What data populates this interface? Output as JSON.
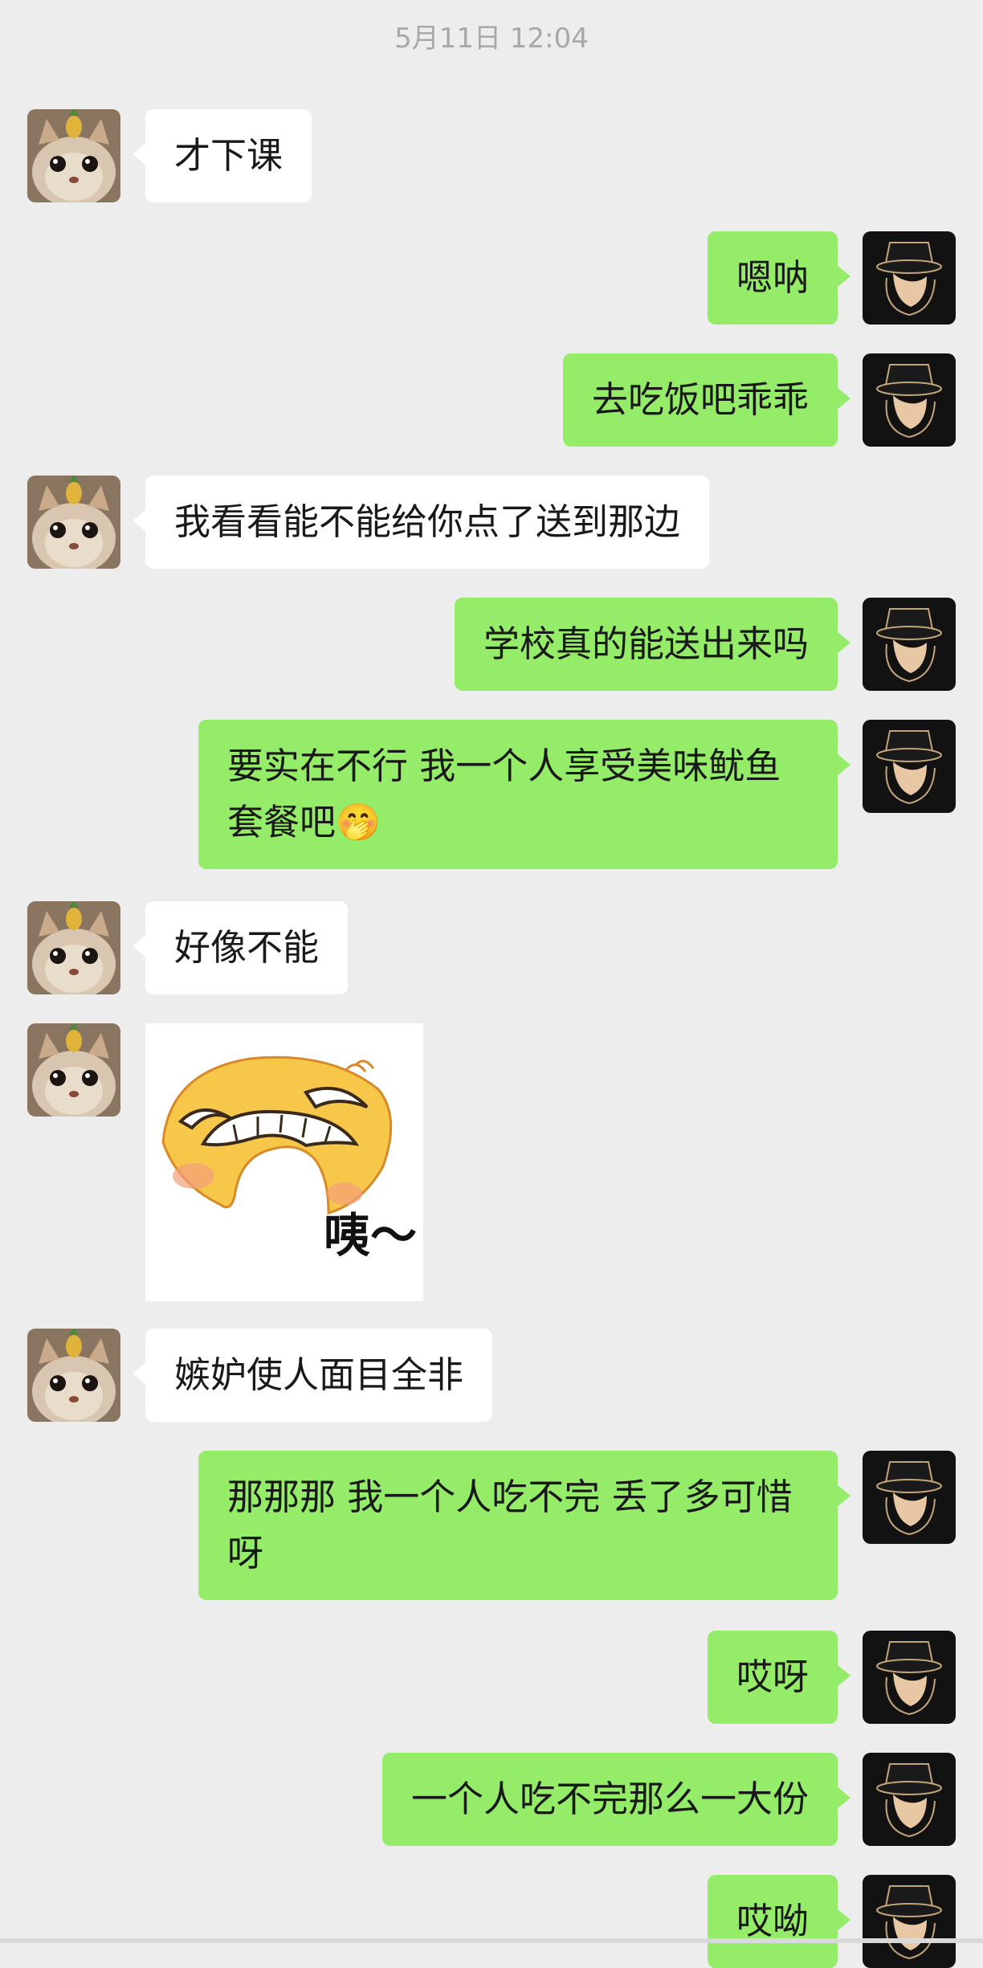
{
  "timestamp": "5月11日 12:04",
  "messages": [
    {
      "side": "recv",
      "text": "才下课"
    },
    {
      "side": "sent",
      "text": "嗯呐"
    },
    {
      "side": "sent",
      "text": "去吃饭吧乖乖"
    },
    {
      "side": "recv",
      "text": "我看看能不能给你点了送到那边"
    },
    {
      "side": "sent",
      "text": "学校真的能送出来吗"
    },
    {
      "side": "sent",
      "text": "要实在不行 我一个人享受美味鱿鱼套餐吧🤭"
    },
    {
      "side": "recv",
      "text": "好像不能"
    },
    {
      "side": "recv",
      "type": "sticker",
      "caption": "咦～",
      "icon": "grimacing-face-sticker"
    },
    {
      "side": "recv",
      "text": "嫉妒使人面目全非"
    },
    {
      "side": "sent",
      "text": "那那那 我一个人吃不完 丢了多可惜呀"
    },
    {
      "side": "sent",
      "text": "哎呀"
    },
    {
      "side": "sent",
      "text": "一个人吃不完那么一大份"
    },
    {
      "side": "sent",
      "text": "哎呦"
    }
  ],
  "avatars": {
    "recv": {
      "icon": "cat-with-pineapple-avatar"
    },
    "sent": {
      "icon": "hat-figure-avatar"
    }
  },
  "colors": {
    "background": "#ededed",
    "sent_bubble": "#95ec69",
    "recv_bubble": "#ffffff",
    "timestamp": "#a8a8a8"
  }
}
